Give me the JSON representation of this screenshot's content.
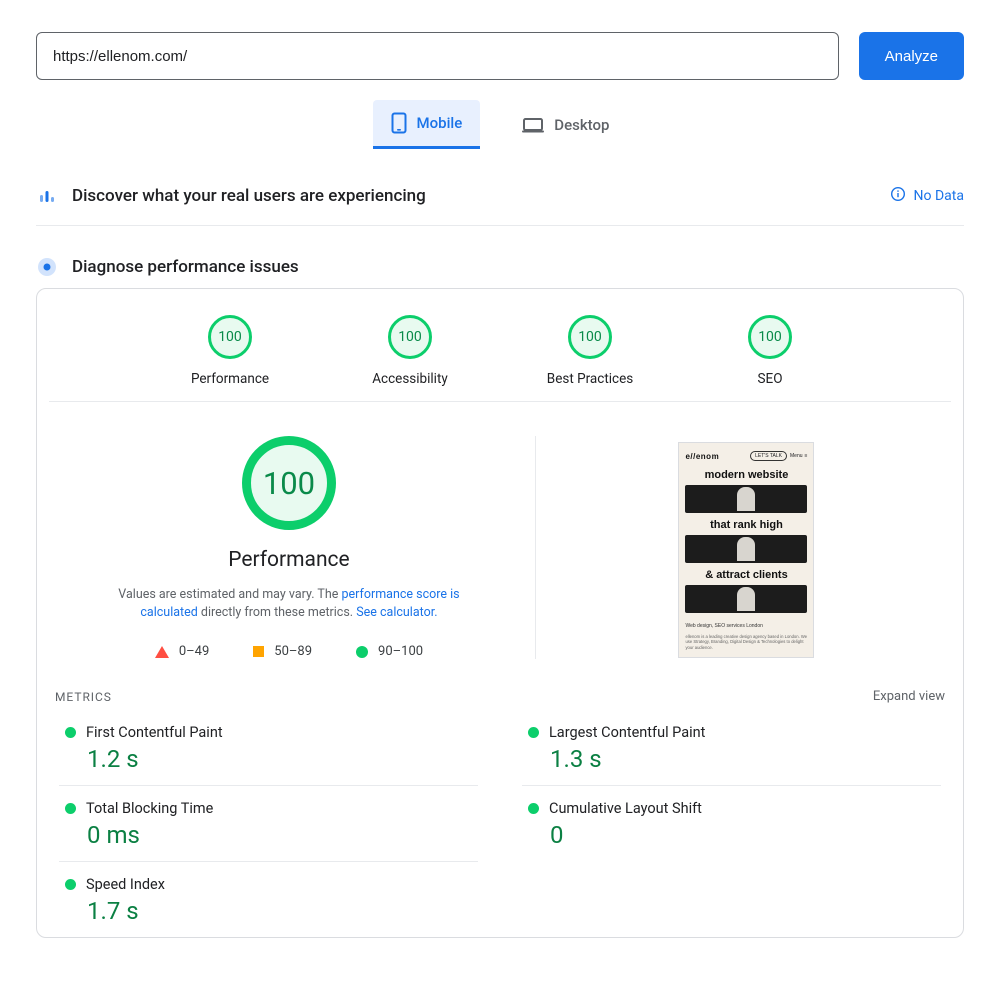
{
  "url_input": {
    "value": "https://ellenom.com/"
  },
  "analyze_button": "Analyze",
  "tabs": {
    "mobile": "Mobile",
    "desktop": "Desktop"
  },
  "discover": {
    "title": "Discover what your real users are experiencing",
    "no_data": "No Data"
  },
  "diagnose": {
    "title": "Diagnose performance issues"
  },
  "gauges": [
    {
      "score": "100",
      "label": "Performance"
    },
    {
      "score": "100",
      "label": "Accessibility"
    },
    {
      "score": "100",
      "label": "Best Practices"
    },
    {
      "score": "100",
      "label": "SEO"
    }
  ],
  "big_performance": {
    "score": "100",
    "label": "Performance"
  },
  "description": {
    "pre": "Values are estimated and may vary. The ",
    "link1": "performance score is calculated",
    "mid": " directly from these metrics. ",
    "link2": "See calculator."
  },
  "legend": {
    "low": "0–49",
    "mid": "50–89",
    "high": "90–100"
  },
  "preview": {
    "logo": "e//enom",
    "cta": "LET'S TALK",
    "menu": "Menu",
    "h1": "modern website",
    "h2": "that rank high",
    "h3": "& attract clients",
    "sub1": "Web design, SEO services London",
    "sub2": "ellenom is a leading creative design agency based in London. We use Strategy, Branding, Digital Design & Technologies to delight your audience."
  },
  "metrics_header": "METRICS",
  "expand_view": "Expand view",
  "metrics": [
    {
      "name": "First Contentful Paint",
      "value": "1.2 s"
    },
    {
      "name": "Largest Contentful Paint",
      "value": "1.3 s"
    },
    {
      "name": "Total Blocking Time",
      "value": "0 ms"
    },
    {
      "name": "Cumulative Layout Shift",
      "value": "0"
    },
    {
      "name": "Speed Index",
      "value": "1.7 s"
    }
  ]
}
